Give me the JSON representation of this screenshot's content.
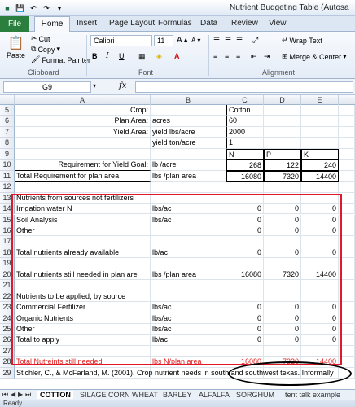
{
  "window": {
    "title": "Nutrient Budgeting Table (Autosa"
  },
  "ribbon_tabs": {
    "file": "File",
    "home": "Home",
    "insert": "Insert",
    "page_layout": "Page Layout",
    "formulas": "Formulas",
    "data": "Data",
    "review": "Review",
    "view": "View"
  },
  "clipboard": {
    "cut": "Cut",
    "copy": "Copy",
    "paste": "Paste",
    "format_painter": "Format Painter",
    "group": "Clipboard"
  },
  "font": {
    "name": "Calibri",
    "size": "11",
    "grow": "A",
    "shrink": "A",
    "bold": "B",
    "italic": "I",
    "underline": "U",
    "color_a": "A",
    "group": "Font"
  },
  "alignment": {
    "wrap_text": "Wrap Text",
    "merge_center": "Merge & Center",
    "group": "Alignment"
  },
  "formula_bar": {
    "name_box": "G9",
    "fx": "fx"
  },
  "columns": [
    "A",
    "B",
    "C",
    "D",
    "E"
  ],
  "rows": [
    {
      "n": "5",
      "a": "Crop:",
      "b": "",
      "c": "Cotton",
      "d": "",
      "e": ""
    },
    {
      "n": "6",
      "a": "Plan Area:",
      "b": "acres",
      "c": "60",
      "d": "",
      "e": ""
    },
    {
      "n": "7",
      "a": "Yield Area:",
      "b": "yield lbs/acre",
      "c": "2000",
      "d": "",
      "e": ""
    },
    {
      "n": "8",
      "a": "",
      "b": "yield ton/acre",
      "c": "1",
      "d": "",
      "e": ""
    },
    {
      "n": "9",
      "a": "",
      "b": "",
      "c": "N",
      "d": "P",
      "e": "K"
    },
    {
      "n": "10",
      "a": "Requirement for Yield Goal:",
      "b": "lb /acre",
      "c": "268",
      "d": "122",
      "e": "240"
    },
    {
      "n": "11",
      "a": "Total Requirement for plan area",
      "b": "lbs /plan area",
      "c": "16080",
      "d": "7320",
      "e": "14400"
    },
    {
      "n": "12",
      "a": "",
      "b": "",
      "c": "",
      "d": "",
      "e": ""
    },
    {
      "n": "13",
      "a": "Nutrients from sources not fertilizers",
      "b": "",
      "c": "",
      "d": "",
      "e": ""
    },
    {
      "n": "14",
      "a": "Irrigation water N",
      "b": "lbs/ac",
      "c": "0",
      "d": "0",
      "e": "0"
    },
    {
      "n": "15",
      "a": "Soil Analysis",
      "b": "lbs/ac",
      "c": "0",
      "d": "0",
      "e": "0"
    },
    {
      "n": "16",
      "a": "Other",
      "b": "",
      "c": "0",
      "d": "0",
      "e": "0"
    },
    {
      "n": "17",
      "a": "",
      "b": "",
      "c": "",
      "d": "",
      "e": ""
    },
    {
      "n": "18",
      "a": "Total nutrients already available",
      "b": "lb/ac",
      "c": "0",
      "d": "0",
      "e": "0"
    },
    {
      "n": "19",
      "a": "",
      "b": "",
      "c": "",
      "d": "",
      "e": ""
    },
    {
      "n": "20",
      "a": "Total nutrients still needed in plan are",
      "b": "lbs /plan area",
      "c": "16080",
      "d": "7320",
      "e": "14400"
    },
    {
      "n": "21",
      "a": "",
      "b": "",
      "c": "",
      "d": "",
      "e": ""
    },
    {
      "n": "22",
      "a": "Nutrients to be applied, by source",
      "b": "",
      "c": "",
      "d": "",
      "e": ""
    },
    {
      "n": "23",
      "a": "Commercial Fertilizer",
      "b": "lbs/ac",
      "c": "0",
      "d": "0",
      "e": "0"
    },
    {
      "n": "24",
      "a": "Organic Nutrients",
      "b": "lbs/ac",
      "c": "0",
      "d": "0",
      "e": "0"
    },
    {
      "n": "25",
      "a": "Other",
      "b": "lbs/ac",
      "c": "0",
      "d": "0",
      "e": "0"
    },
    {
      "n": "26",
      "a": "Total to apply",
      "b": "lb/ac",
      "c": "0",
      "d": "0",
      "e": "0"
    },
    {
      "n": "27",
      "a": "",
      "b": "",
      "c": "",
      "d": "",
      "e": ""
    },
    {
      "n": "28",
      "a": "Total Nutreints still needed",
      "b": "lbs N/plan area",
      "c": "16080",
      "d": "7320",
      "e": "14400",
      "red": true
    },
    {
      "n": "29",
      "a": "Stichler, C., & McFarland, M. (2001). Crop nutrient needs in south and southwest texas. Informally",
      "b": "",
      "c": "",
      "d": "",
      "e": ""
    }
  ],
  "sheet_tabs": [
    "COTTON",
    "SILAGE CORN",
    "WHEAT",
    "BARLEY",
    "ALFALFA",
    "SORGHUM",
    "tent talk example"
  ],
  "status": {
    "text": "Ready"
  },
  "colors": {
    "file_tab": "#2a7f3e",
    "highlight_box": "#e0182a",
    "red_text": "#e02020"
  }
}
